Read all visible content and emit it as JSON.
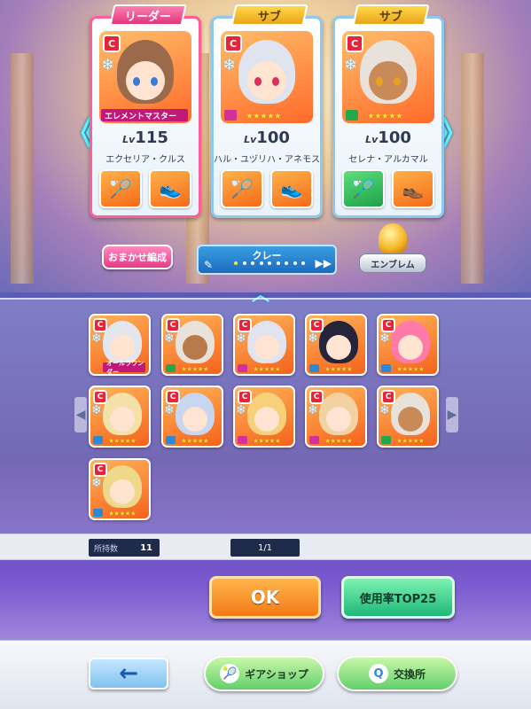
{
  "lineup": {
    "cards": [
      {
        "tag": "リーダー",
        "level_prefix": "Lv",
        "level": "115",
        "name": "エクセリア・クルス",
        "skill": "エレメントマスター",
        "rarity": "C"
      },
      {
        "tag": "サブ",
        "level_prefix": "Lv",
        "level": "100",
        "name": "ハル・ユヅリハ・アネモス",
        "stars": "★★★★★",
        "rarity": "C"
      },
      {
        "tag": "サブ",
        "level_prefix": "Lv",
        "level": "100",
        "name": "セレナ・アルカマル",
        "stars": "★★★★★",
        "rarity": "C"
      }
    ],
    "left_arrow": "《",
    "right_arrow": "》"
  },
  "controls": {
    "omakase_label": "おまかせ編成",
    "team_name": "クレー",
    "pen_icon": "✎",
    "skip_icon": "▶▶",
    "emblem_label": "エンブレム",
    "collapse_icon": "︿"
  },
  "roster": {
    "rarity": "C",
    "stars": "★★★★★",
    "row1_skill": "オールラウンダー",
    "left_arrow": "◀",
    "right_arrow": "▶"
  },
  "counter": {
    "owned_label": "所持数",
    "owned_value": "11",
    "page_value": "1/1"
  },
  "buttons": {
    "ok_label": "OK",
    "top25_label": "使用率TOP25",
    "back_icon": "←",
    "gear_shop_label": "ギアショップ",
    "exchange_label": "交換所",
    "gear_shop_icon": "🎾",
    "exchange_icon": "Q"
  },
  "colors": {
    "leader_tag": "#e2357a",
    "sub_tag": "#e9a418",
    "ok_button": "#f37a16",
    "top25_button": "#1fb87a",
    "accent_cyan": "#5cf6ff"
  }
}
